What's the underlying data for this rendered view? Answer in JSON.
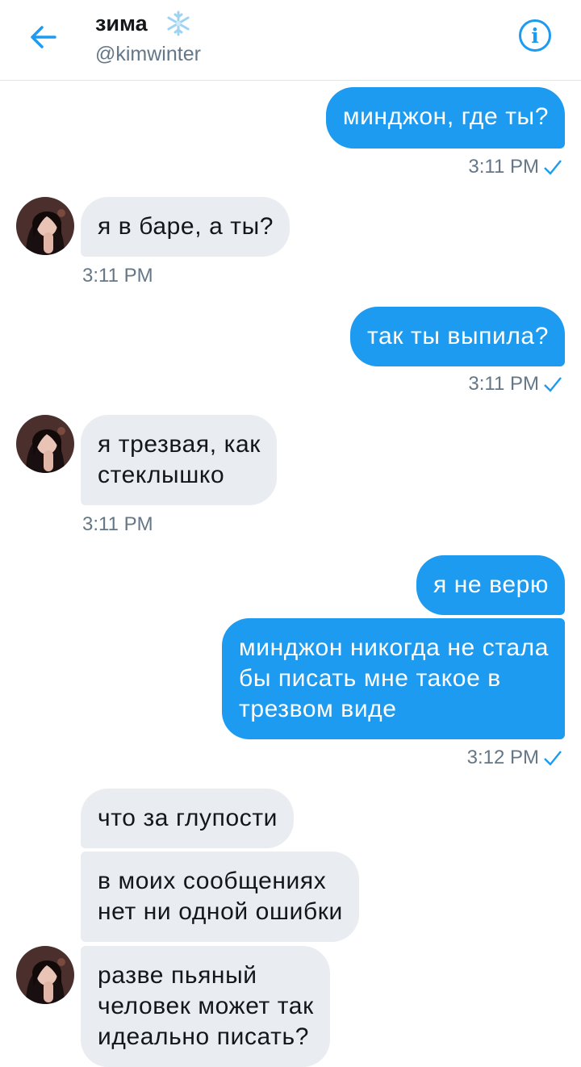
{
  "header": {
    "name": "зима",
    "handle": "@kimwinter",
    "back_icon": "arrow-left-icon",
    "info_icon": "info-icon",
    "name_emoji": "snowflake-icon"
  },
  "messages": [
    {
      "dir": "out",
      "text": "минджон, где ты?"
    },
    {
      "dir": "out-time",
      "text": "3:11 PM"
    },
    {
      "dir": "in",
      "text": "я в баре, а ты?"
    },
    {
      "dir": "in-time",
      "text": "3:11 PM"
    },
    {
      "dir": "out",
      "text": "так ты выпила?"
    },
    {
      "dir": "out-time",
      "text": "3:11 PM"
    },
    {
      "dir": "in",
      "lines": [
        "я трезвая, как",
        "стеклышко"
      ]
    },
    {
      "dir": "in-time",
      "text": "3:11 PM"
    },
    {
      "dir": "out",
      "text": "я не верю"
    },
    {
      "dir": "out",
      "lines": [
        "минджон никогда не стала",
        "бы писать мне такое в",
        "трезвом виде"
      ]
    },
    {
      "dir": "out-time",
      "text": "3:12 PM"
    },
    {
      "dir": "in",
      "text": "что за глупости"
    },
    {
      "dir": "in",
      "lines": [
        "в моих сообщениях",
        "нет ни одной ошибки"
      ]
    },
    {
      "dir": "in",
      "lines": [
        "разве пьяный",
        "человек может так",
        "идеально писать?"
      ]
    }
  ],
  "colors": {
    "accent": "#1c9bf0",
    "incoming_bubble": "#e9ecf0",
    "timestamp": "#657786"
  }
}
